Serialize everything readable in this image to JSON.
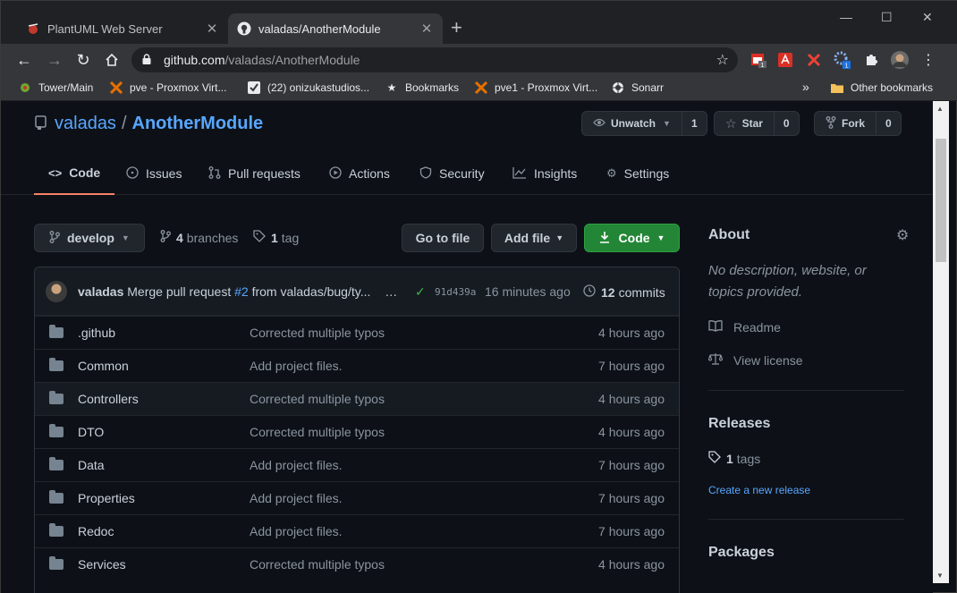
{
  "browser": {
    "tabs": [
      {
        "title": "PlantUML Web Server",
        "active": false
      },
      {
        "title": "valadas/AnotherModule",
        "active": true
      }
    ],
    "new_tab": "+",
    "address": {
      "host": "github.com",
      "path": "/valadas/AnotherModule"
    },
    "extensions": [
      {
        "icon": "calendar-extension-icon",
        "badge": "1"
      },
      {
        "icon": "pdf-extension-icon"
      },
      {
        "icon": "x-extension-icon"
      },
      {
        "icon": "gear-extension-icon",
        "badge": "1"
      },
      {
        "icon": "puzzle-icon"
      },
      {
        "icon": "profile-avatar"
      }
    ],
    "bookmarks": [
      {
        "label": "Tower/Main",
        "icon": "green-dot-icon"
      },
      {
        "label": "pve - Proxmox Virt...",
        "icon": "proxmox-icon"
      },
      {
        "label": "(22) onizukastudios...",
        "icon": "check-icon"
      },
      {
        "label": "Bookmarks",
        "icon": "star-icon"
      },
      {
        "label": "pve1 - Proxmox Virt...",
        "icon": "proxmox-icon"
      },
      {
        "label": "Sonarr",
        "icon": "sonarr-icon"
      }
    ],
    "overflow": "»",
    "other_bookmarks": "Other bookmarks"
  },
  "repo": {
    "owner": "valadas",
    "separator": "/",
    "name": "AnotherModule",
    "watch": {
      "label": "Unwatch",
      "count": "1"
    },
    "star": {
      "label": "Star",
      "count": "0"
    },
    "fork": {
      "label": "Fork",
      "count": "0"
    }
  },
  "nav_tabs": [
    {
      "label": "Code",
      "active": true
    },
    {
      "label": "Issues"
    },
    {
      "label": "Pull requests"
    },
    {
      "label": "Actions"
    },
    {
      "label": "Security"
    },
    {
      "label": "Insights"
    },
    {
      "label": "Settings"
    }
  ],
  "toolbar": {
    "branch": "develop",
    "branches_count": "4",
    "branches_label": "branches",
    "tags_count": "1",
    "tags_label": "tag",
    "go_to_file": "Go to file",
    "add_file": "Add file",
    "code": "Code"
  },
  "last_commit": {
    "author": "valadas",
    "message_prefix": "Merge pull request",
    "pr": "#2",
    "message_suffix": "from valadas/bug/ty...",
    "ellipsis": "…",
    "sha": "91d439a",
    "time": "16 minutes ago",
    "commits_count": "12",
    "commits_label": "commits"
  },
  "files": [
    {
      "name": ".github",
      "message": "Corrected multiple typos",
      "age": "4 hours ago"
    },
    {
      "name": "Common",
      "message": "Add project files.",
      "age": "7 hours ago"
    },
    {
      "name": "Controllers",
      "message": "Corrected multiple typos",
      "age": "4 hours ago"
    },
    {
      "name": "DTO",
      "message": "Corrected multiple typos",
      "age": "4 hours ago"
    },
    {
      "name": "Data",
      "message": "Add project files.",
      "age": "7 hours ago"
    },
    {
      "name": "Properties",
      "message": "Add project files.",
      "age": "7 hours ago"
    },
    {
      "name": "Redoc",
      "message": "Add project files.",
      "age": "7 hours ago"
    },
    {
      "name": "Services",
      "message": "Corrected multiple typos",
      "age": "4 hours ago"
    }
  ],
  "about": {
    "heading": "About",
    "description": "No description, website, or topics provided.",
    "readme": "Readme",
    "license": "View license"
  },
  "releases": {
    "heading": "Releases",
    "tags_count": "1",
    "tags_label": "tags",
    "create": "Create a new release"
  },
  "packages": {
    "heading": "Packages"
  },
  "colors": {
    "accent_link": "#58a6ff",
    "primary_button": "#238636",
    "active_tab_underline": "#f78166",
    "background": "#0d1117"
  }
}
